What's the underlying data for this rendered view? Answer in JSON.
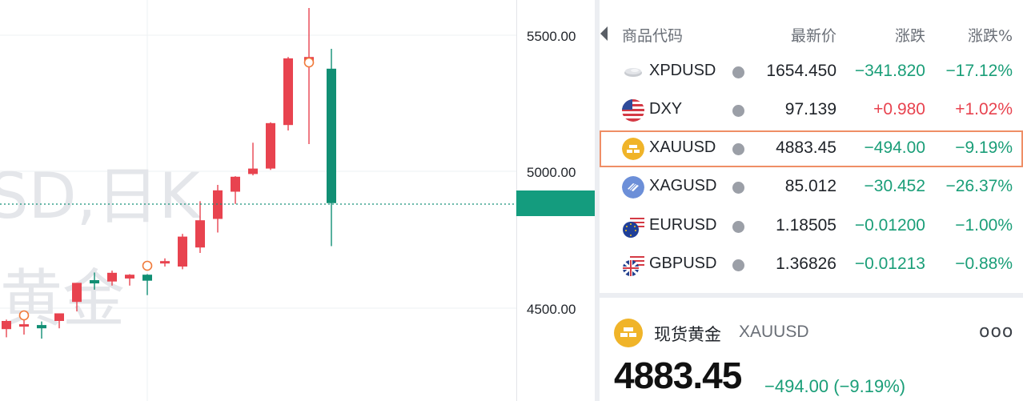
{
  "chart": {
    "watermark_line1": "SD,日K",
    "watermark_line2": "黄金",
    "price_axis": [
      "5500.00",
      "5000.00",
      "4500.00"
    ],
    "colors": {
      "up": "#e8434f",
      "down": "#118f74",
      "dotted_line": "#138f77",
      "current_price_box": "#149c7e"
    }
  },
  "chart_data": {
    "type": "candlestick",
    "xlabel": "",
    "ylabel": "",
    "ylim": [
      4375,
      5625
    ],
    "candles": [
      {
        "open": 4420,
        "high": 4455,
        "low": 4390,
        "close": 4450,
        "dir": "up"
      },
      {
        "open": 4438,
        "high": 4460,
        "low": 4400,
        "close": 4438,
        "dir": "up"
      },
      {
        "open": 4435,
        "high": 4448,
        "low": 4385,
        "close": 4423,
        "dir": "down"
      },
      {
        "open": 4450,
        "high": 4478,
        "low": 4423,
        "close": 4478,
        "dir": "up"
      },
      {
        "open": 4520,
        "high": 4588,
        "low": 4485,
        "close": 4590,
        "dir": "up"
      },
      {
        "open": 4600,
        "high": 4628,
        "low": 4565,
        "close": 4588,
        "dir": "down"
      },
      {
        "open": 4595,
        "high": 4635,
        "low": 4580,
        "close": 4627,
        "dir": "up"
      },
      {
        "open": 4606,
        "high": 4622,
        "low": 4580,
        "close": 4620,
        "dir": "up"
      },
      {
        "open": 4620,
        "high": 4622,
        "low": 4545,
        "close": 4598,
        "dir": "down"
      },
      {
        "open": 4665,
        "high": 4680,
        "low": 4650,
        "close": 4670,
        "dir": "up"
      },
      {
        "open": 4650,
        "high": 4770,
        "low": 4640,
        "close": 4760,
        "dir": "up"
      },
      {
        "open": 4720,
        "high": 4890,
        "low": 4700,
        "close": 4820,
        "dir": "up"
      },
      {
        "open": 4825,
        "high": 4950,
        "low": 4775,
        "close": 4930,
        "dir": "up"
      },
      {
        "open": 4925,
        "high": 4982,
        "low": 4880,
        "close": 4980,
        "dir": "up"
      },
      {
        "open": 4990,
        "high": 5105,
        "low": 4985,
        "close": 5010,
        "dir": "up"
      },
      {
        "open": 5010,
        "high": 5180,
        "low": 5005,
        "close": 5177,
        "dir": "up"
      },
      {
        "open": 5170,
        "high": 5420,
        "low": 5150,
        "close": 5415,
        "dir": "up"
      },
      {
        "open": 5420,
        "high": 5600,
        "low": 5100,
        "close": 5405,
        "dir": "up"
      },
      {
        "open": 5377,
        "high": 5450,
        "low": 4725,
        "close": 4883,
        "dir": "down"
      }
    ],
    "markers_at": [
      1,
      8,
      17
    ],
    "current_price": 4883.45
  },
  "watchlist": {
    "headers": {
      "code": "商品代码",
      "price": "最新价",
      "change": "涨跌",
      "pct": "涨跌%"
    },
    "rows": [
      {
        "symbol": "XPDUSD",
        "price": "1654.450",
        "change": "−341.820",
        "pct": "−17.12%",
        "trend": "down",
        "icon": "palladium-icon"
      },
      {
        "symbol": "DXY",
        "price": "97.139",
        "change": "+0.980",
        "pct": "+1.02%",
        "trend": "up",
        "icon": "us-flag-icon"
      },
      {
        "symbol": "XAUUSD",
        "price": "4883.45",
        "change": "−494.00",
        "pct": "−9.19%",
        "trend": "down",
        "icon": "gold-icon",
        "selected": true
      },
      {
        "symbol": "XAGUSD",
        "price": "85.012",
        "change": "−30.452",
        "pct": "−26.37%",
        "trend": "down",
        "icon": "silver-icon"
      },
      {
        "symbol": "EURUSD",
        "price": "1.18505",
        "change": "−0.01200",
        "pct": "−1.00%",
        "trend": "down",
        "icon": "eu-us-flag-icon"
      },
      {
        "symbol": "GBPUSD",
        "price": "1.36826",
        "change": "−0.01213",
        "pct": "−0.88%",
        "trend": "down",
        "icon": "uk-us-flag-icon"
      }
    ]
  },
  "detail": {
    "name": "现货黄金",
    "code": "XAUUSD",
    "more": "ooo",
    "price": "4883.45",
    "change": "−494.00 (−9.19%)"
  }
}
